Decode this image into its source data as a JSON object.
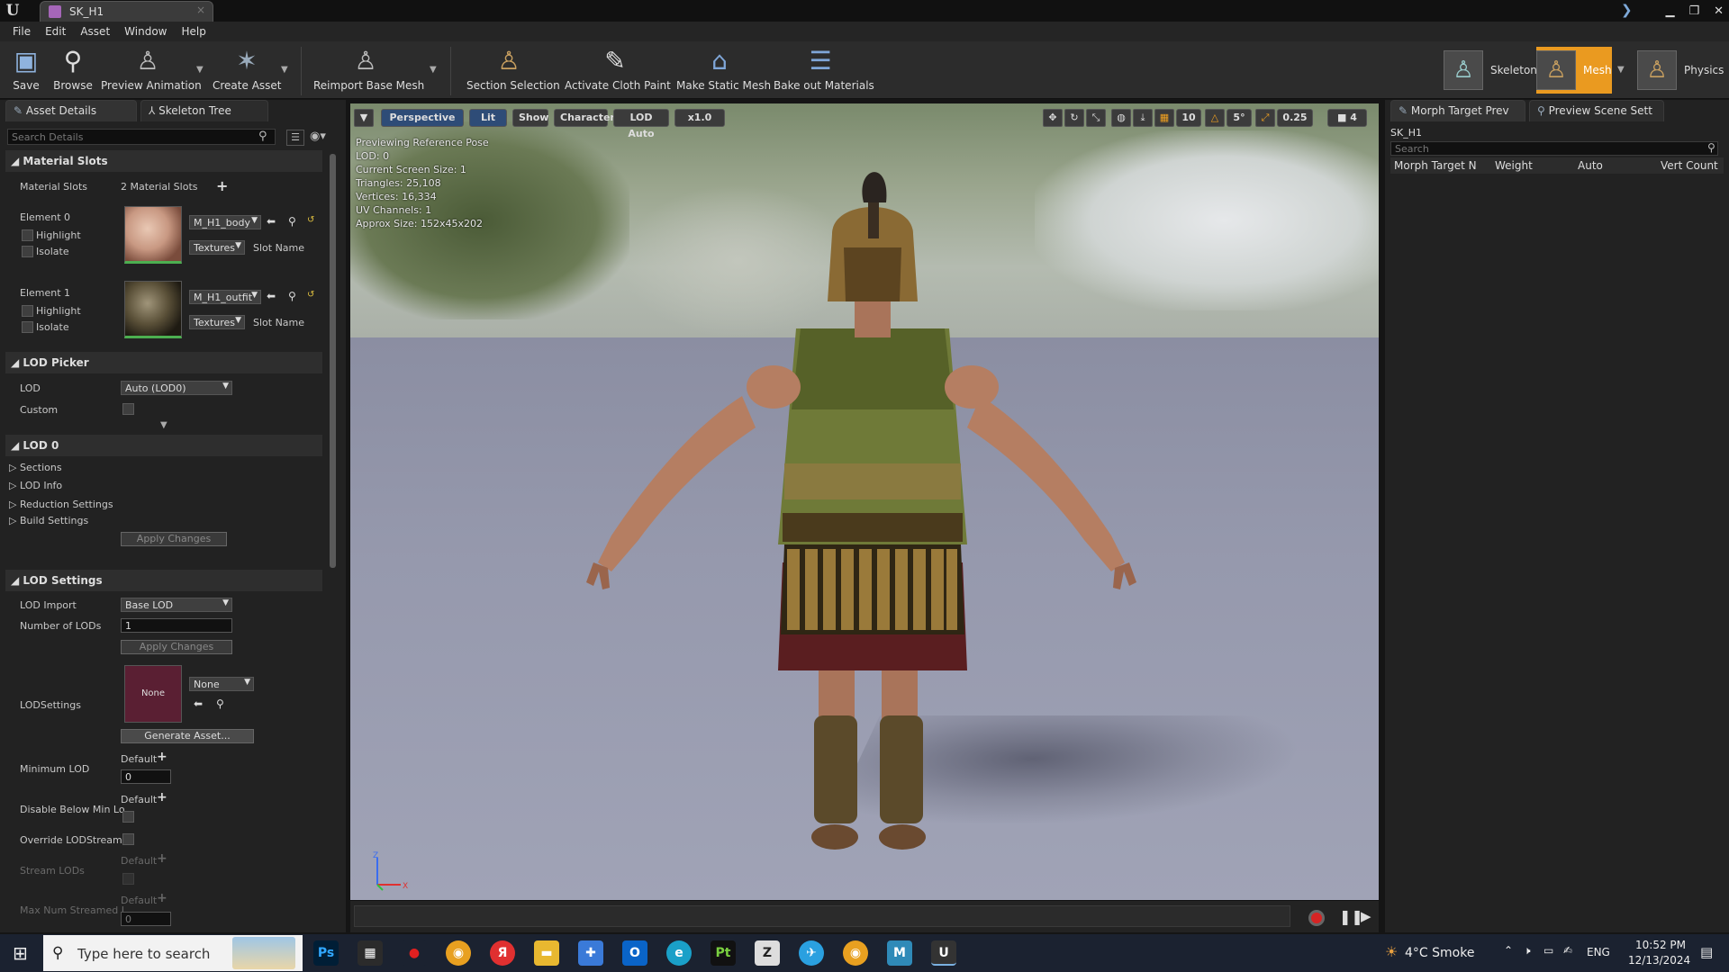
{
  "window": {
    "tab_title": "SK_H1",
    "tab_close": "×",
    "controls": [
      "▁",
      "❐",
      "✕"
    ]
  },
  "menu": [
    "File",
    "Edit",
    "Asset",
    "Window",
    "Help"
  ],
  "toolbar": {
    "save": "Save",
    "browse": "Browse",
    "preview_animation": "Preview Animation",
    "create_asset": "Create Asset",
    "reimport": "Reimport Base Mesh",
    "section_selection": "Section Selection",
    "activate_cloth": "Activate Cloth Paint",
    "make_static": "Make Static Mesh",
    "bake_out": "Bake out Materials",
    "modes": {
      "skeleton": "Skeleton",
      "mesh": "Mesh",
      "physics": "Physics"
    }
  },
  "left_panel": {
    "tabs": [
      "Asset Details",
      "Skeleton Tree"
    ],
    "search_placeholder": "Search Details",
    "material_slots": {
      "header": "Material Slots",
      "label": "Material Slots",
      "count": "2 Material Slots",
      "elements": [
        {
          "name": "Element 0",
          "material": "M_H1_body",
          "highlight": "Highlight",
          "isolate": "Isolate",
          "textures": "Textures",
          "slot_name": "Slot Name"
        },
        {
          "name": "Element 1",
          "material": "M_H1_outfit",
          "highlight": "Highlight",
          "isolate": "Isolate",
          "textures": "Textures",
          "slot_name": "Slot Name"
        }
      ]
    },
    "lod_picker": {
      "header": "LOD Picker",
      "lod_label": "LOD",
      "lod_value": "Auto (LOD0)",
      "custom_label": "Custom"
    },
    "lod0": {
      "header": "LOD 0",
      "items": [
        "Sections",
        "LOD Info",
        "Reduction Settings",
        "Build Settings"
      ],
      "apply": "Apply Changes"
    },
    "lod_settings": {
      "header": "LOD Settings",
      "lod_import_label": "LOD Import",
      "lod_import_value": "Base LOD",
      "num_lods_label": "Number of LODs",
      "num_lods_value": "1",
      "apply": "Apply Changes",
      "lodsettings_label": "LODSettings",
      "lodsettings_swatch": "None",
      "lodsettings_value": "None",
      "generate": "Generate Asset...",
      "min_lod_label": "Minimum LOD",
      "default": "Default",
      "min_lod_value": "0",
      "disable_below_label": "Disable Below Min Lo",
      "override_label": "Override LODStreami",
      "stream_lods_label": "Stream LODs",
      "max_num_label": "Max Num Streamed I",
      "max_num_value": "0"
    }
  },
  "viewport": {
    "perspective": "Perspective",
    "lit": "Lit",
    "show": "Show",
    "character": "Character",
    "lod_auto": "LOD Auto",
    "speed": "x1.0",
    "grid_value": "10",
    "angle_value": "5°",
    "scale_value": "0.25",
    "cam_speed": "4",
    "stats": [
      "Previewing Reference Pose",
      "LOD: 0",
      "Current Screen Size: 1",
      "Triangles: 25,108",
      "Vertices: 16,334",
      "UV Channels: 1",
      "Approx Size: 152x45x202"
    ],
    "axis": {
      "z": "Z",
      "x": "X"
    }
  },
  "right_panel": {
    "tabs": [
      "Morph Target Prev",
      "Preview Scene Sett"
    ],
    "asset": "SK_H1",
    "search_placeholder": "Search",
    "columns": [
      "Morph Target N",
      "Weight",
      "Auto",
      "Vert Count"
    ]
  },
  "taskbar": {
    "search_placeholder": "Type here to search",
    "weather": "4°C  Smoke",
    "lang": "ENG",
    "time": "10:52 PM",
    "date": "12/13/2024",
    "apps": [
      "Ps",
      "▦",
      "●",
      "◉",
      "Я",
      "▬",
      "✚",
      "O",
      "e",
      "Pt",
      "Z",
      "✈",
      "◉",
      "M",
      "U"
    ]
  }
}
